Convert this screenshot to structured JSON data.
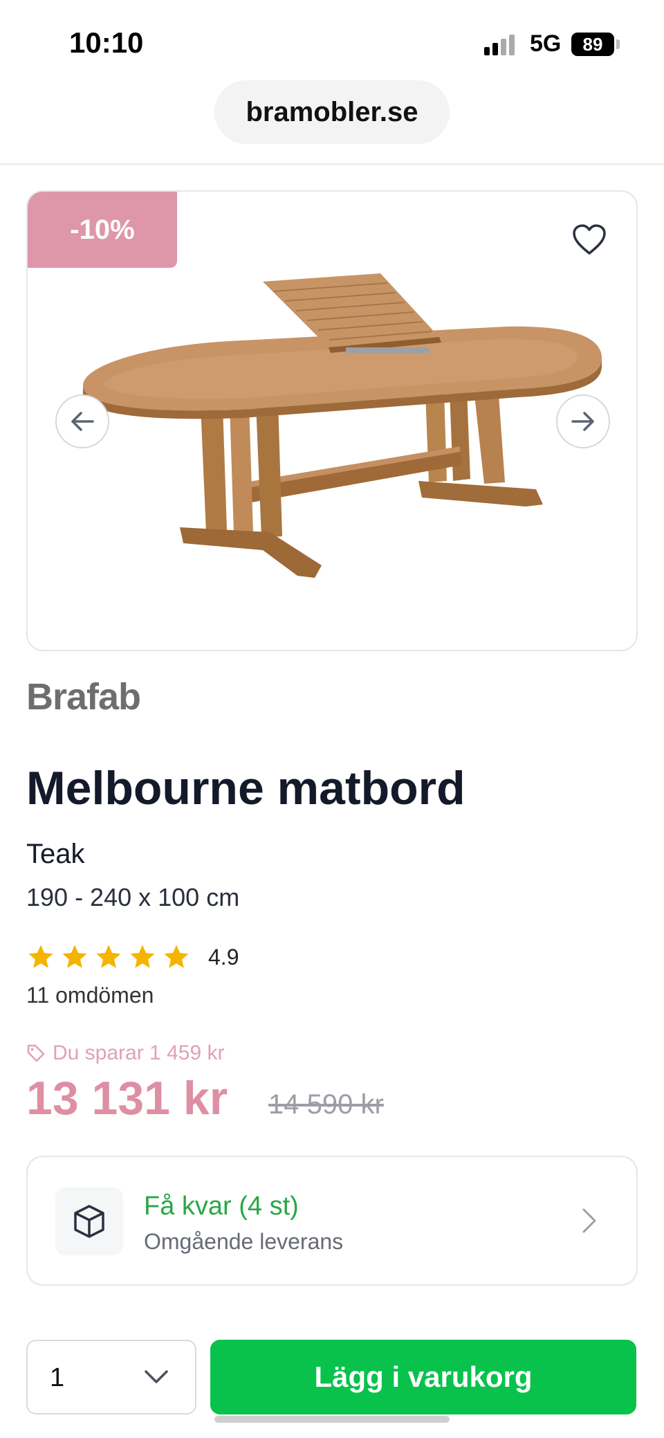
{
  "status_bar": {
    "time": "10:10",
    "network": "5G",
    "battery": "89"
  },
  "browser": {
    "url": "bramobler.se"
  },
  "product": {
    "discount_badge": "-10%",
    "image_alt": "Teak dining table with extension leaf",
    "brand": "Brafab",
    "title": "Melbourne matbord",
    "material": "Teak",
    "dimensions": "190 - 240 x 100 cm",
    "rating": {
      "stars": 5,
      "value": "4.9",
      "reviews": "11 omdömen"
    },
    "savings": "Du sparar 1 459 kr",
    "price": "13 131 kr",
    "old_price": "14 590 kr"
  },
  "stock": {
    "title": "Få kvar (4 st)",
    "subtitle": "Omgående leverans"
  },
  "cart": {
    "quantity": "1",
    "add_label": "Lägg i varukorg"
  },
  "colors": {
    "badge": "#de96a9",
    "price": "#de8fa4",
    "stock_green": "#2aa748",
    "cta_green": "#08c24c",
    "star": "#f5b400"
  }
}
